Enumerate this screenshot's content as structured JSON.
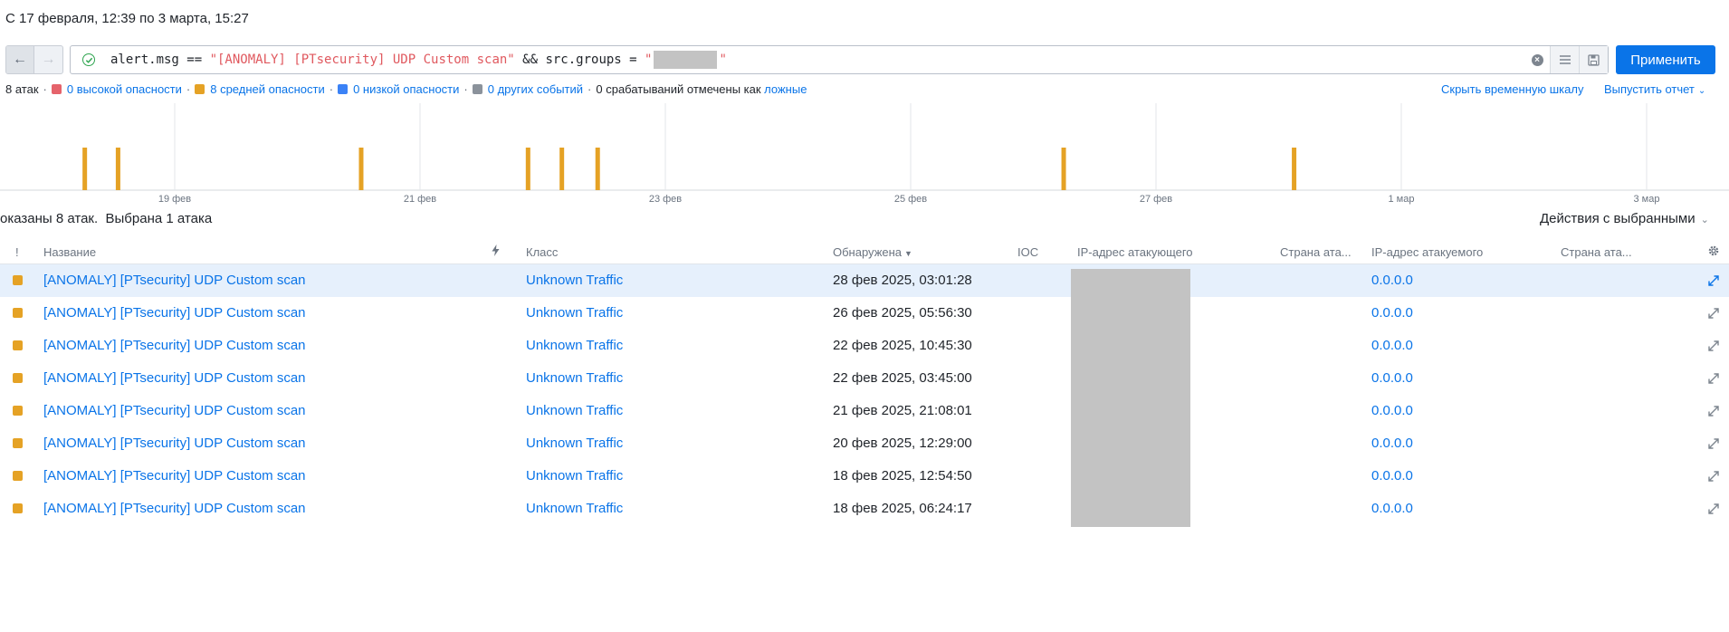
{
  "period": "С 17 февраля, 12:39 по 3 марта, 15:27",
  "query": {
    "part1": "alert.msg == ",
    "str1": "\"[ANOMALY] [PTsecurity] UDP Custom scan\"",
    "part2": " && src.groups = ",
    "quote": "\""
  },
  "apply_label": "Применить",
  "summary": {
    "attacks": "8 атак",
    "high": "0 высокой опасности",
    "medium": "8 средней опасности",
    "low": "0 низкой опасности",
    "other": "0 других событий",
    "false_prefix": "0 срабатываний отмечены как",
    "false_link": "ложные"
  },
  "hide_timeline": "Скрыть временную шкалу",
  "report": "Выпустить отчет",
  "timeline": {
    "ticks": [
      "19 фев",
      "21 фев",
      "23 фев",
      "25 фев",
      "27 фев",
      "1 мар",
      "3 мар"
    ],
    "events": [
      "2025-02-18 06:24:17",
      "2025-02-18 12:54:50",
      "2025-02-20 12:29:00",
      "2025-02-21 21:08:01",
      "2025-02-22 03:45:00",
      "2025-02-22 10:45:30",
      "2025-02-26 05:56:30",
      "2025-02-28 03:01:28"
    ]
  },
  "shown_text": "оказаны 8 атак.",
  "selected_text": "Выбрана 1 атака",
  "actions_label": "Действия с выбранными",
  "columns": {
    "severity": "!",
    "name": "Название",
    "class": "Класс",
    "detected": "Обнаружена",
    "ioc": "IOC",
    "src_ip": "IP-адрес атакующего",
    "src_country": "Страна ата...",
    "dst_ip": "IP-адрес атакуемого",
    "dst_country": "Страна ата..."
  },
  "rows": [
    {
      "name": "[ANOMALY] [PTsecurity] UDP Custom scan",
      "class": "Unknown Traffic",
      "time": "28 фев 2025, 03:01:28",
      "dst": "0.0.0.0"
    },
    {
      "name": "[ANOMALY] [PTsecurity] UDP Custom scan",
      "class": "Unknown Traffic",
      "time": "26 фев 2025, 05:56:30",
      "dst": "0.0.0.0"
    },
    {
      "name": "[ANOMALY] [PTsecurity] UDP Custom scan",
      "class": "Unknown Traffic",
      "time": "22 фев 2025, 10:45:30",
      "dst": "0.0.0.0"
    },
    {
      "name": "[ANOMALY] [PTsecurity] UDP Custom scan",
      "class": "Unknown Traffic",
      "time": "22 фев 2025, 03:45:00",
      "dst": "0.0.0.0"
    },
    {
      "name": "[ANOMALY] [PTsecurity] UDP Custom scan",
      "class": "Unknown Traffic",
      "time": "21 фев 2025, 21:08:01",
      "dst": "0.0.0.0"
    },
    {
      "name": "[ANOMALY] [PTsecurity] UDP Custom scan",
      "class": "Unknown Traffic",
      "time": "20 фев 2025, 12:29:00",
      "dst": "0.0.0.0"
    },
    {
      "name": "[ANOMALY] [PTsecurity] UDP Custom scan",
      "class": "Unknown Traffic",
      "time": "18 фев 2025, 12:54:50",
      "dst": "0.0.0.0"
    },
    {
      "name": "[ANOMALY] [PTsecurity] UDP Custom scan",
      "class": "Unknown Traffic",
      "time": "18 фев 2025, 06:24:17",
      "dst": "0.0.0.0"
    }
  ],
  "colors": {
    "accent": "#0a74e8",
    "high": "#e5636b",
    "medium": "#e5a225",
    "low": "#3b82f6",
    "other": "#8b929b"
  }
}
